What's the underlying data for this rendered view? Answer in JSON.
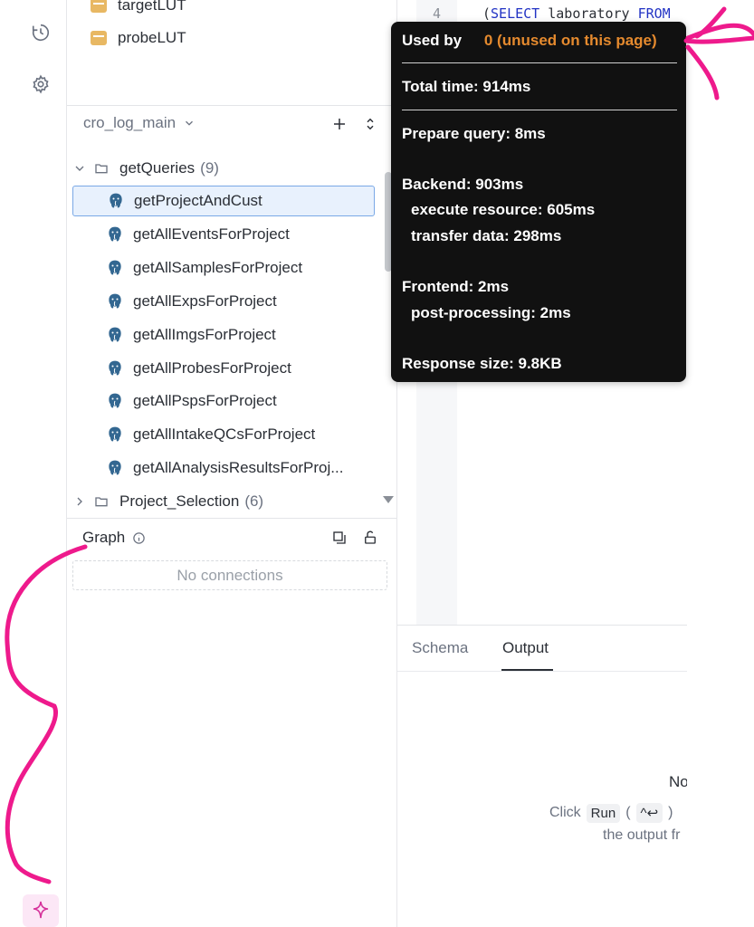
{
  "sidebar": {
    "luts": [
      "targetLUT",
      "probeLUT"
    ],
    "workspace": "cro_log_main",
    "folders": [
      {
        "name": "getQueries",
        "count": "(9)",
        "expanded": true
      },
      {
        "name": "Project_Selection",
        "count": "(6)",
        "expanded": false
      }
    ],
    "queries": [
      "getProjectAndCust",
      "getAllEventsForProject",
      "getAllSamplesForProject",
      "getAllExpsForProject",
      "getAllImgsForProject",
      "getAllProbesForProject",
      "getAllPspsForProject",
      "getAllIntakeQCsForProject",
      "getAllAnalysisResultsForProj..."
    ],
    "selected_index": 0,
    "graph_title": "Graph",
    "no_connections": "No connections"
  },
  "editor": {
    "line_number": "4",
    "code_paren": "(",
    "code_kw1": "SELECT",
    "code_mid": " laboratory ",
    "code_kw2": "FROM",
    "code_tail": " "
  },
  "bottom": {
    "tabs": [
      "Schema",
      "Output"
    ],
    "active_tab": "Output",
    "out_title": "No",
    "click_label": "Click",
    "run_label": "Run",
    "shortcut": "^↩",
    "paren_open": "(",
    "paren_close": ")",
    "out_sub": "the output fr"
  },
  "tooltip": {
    "used_by_label": "Used by",
    "used_by_value": "0 (unused on this page)",
    "total_time": "Total time: 914ms",
    "prepare_query": "Prepare query: 8ms",
    "backend": "Backend: 903ms",
    "execute_resource": "execute resource: 605ms",
    "transfer_data": "transfer data: 298ms",
    "frontend": "Frontend: 2ms",
    "post_processing": "post-processing: 2ms",
    "response_size": "Response size: 9.8KB"
  },
  "colors": {
    "accent_orange": "#e58a2e",
    "selection_bg": "#e8f1fd",
    "annotation_pink": "#ee1a8c",
    "lut_yellow": "#e8b863",
    "pg_blue": "#336791"
  }
}
